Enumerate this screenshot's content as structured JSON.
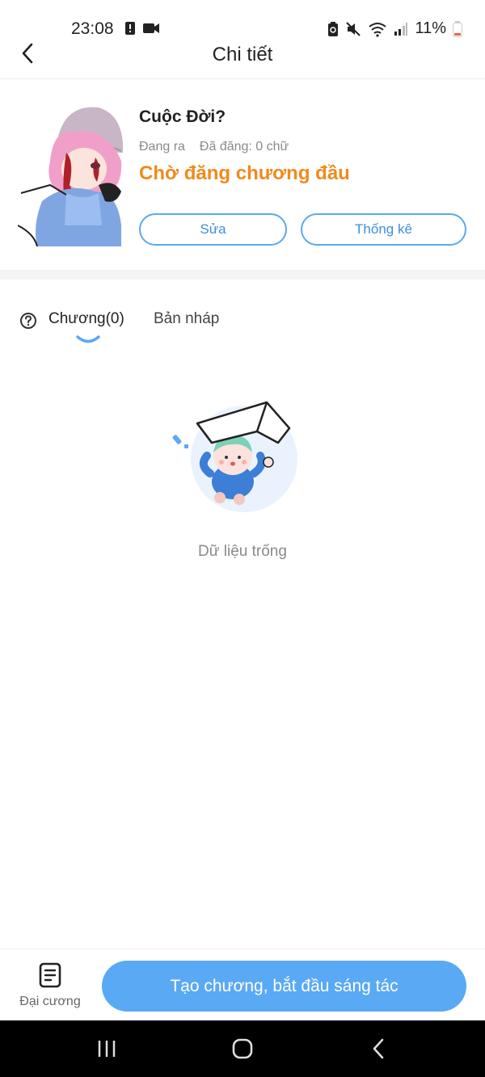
{
  "status_bar": {
    "time": "23:08",
    "battery_text": "11%",
    "icons": [
      "alert-icon",
      "video-icon",
      "battery-saver-icon",
      "mute-icon",
      "wifi-icon",
      "signal-icon",
      "battery-icon"
    ]
  },
  "header": {
    "title": "Chi tiết"
  },
  "book": {
    "title": "Cuộc Đời?",
    "status_text": "Đang ra",
    "published_text": "Đã đăng: 0 chữ",
    "highlight": "Chờ đăng chương đầu",
    "edit_label": "Sửa",
    "stats_label": "Thống kê"
  },
  "tabs": {
    "chapters_label": "Chương(0)",
    "drafts_label": "Bản nháp"
  },
  "empty_state": {
    "text": "Dữ liệu trống"
  },
  "bottom_bar": {
    "outline_label": "Đại cương",
    "create_label": "Tạo chương, bắt đầu sáng tác"
  },
  "colors": {
    "accent": "#5aa9f4",
    "highlight": "#f08a1c",
    "muted_text": "#8a8a8a"
  }
}
